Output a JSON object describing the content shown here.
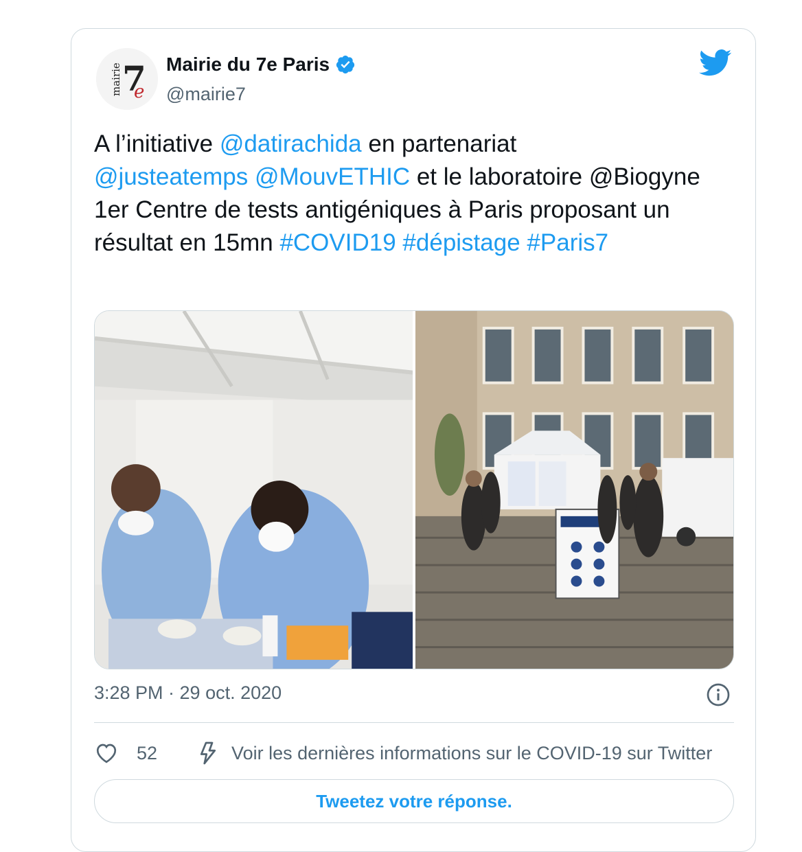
{
  "account": {
    "display_name": "Mairie du 7e Paris",
    "handle": "@mairie7",
    "avatar_text_small": "mairie",
    "avatar_text_big": "7",
    "avatar_text_e": "e"
  },
  "tweet": {
    "segments": [
      {
        "text": "A l’initiative ",
        "link": false
      },
      {
        "text": "@datirachida",
        "link": true
      },
      {
        "text": " en partenariat ",
        "link": false
      },
      {
        "text": "@justeatemps",
        "link": true
      },
      {
        "text": " ",
        "link": false
      },
      {
        "text": "@MouvETHIC",
        "link": true
      },
      {
        "text": " et le laboratoire @Biogyne 1er Centre de tests antigéniques à Paris proposant un résultat en 15mn ",
        "link": false
      },
      {
        "text": "#COVID19",
        "link": true
      },
      {
        "text": " ",
        "link": false
      },
      {
        "text": "#dépistage",
        "link": true
      },
      {
        "text": " ",
        "link": false
      },
      {
        "text": "#Paris7",
        "link": true
      }
    ],
    "timestamp": "3:28 PM · 29 oct. 2020"
  },
  "actions": {
    "like_count": "52",
    "covid_info": "Voir les dernières informations sur le COVID-19 sur Twitter"
  },
  "reply": {
    "label": "Tweetez votre réponse."
  },
  "colors": {
    "accent": "#1d9bf0",
    "text": "#0f1419",
    "muted": "#536471",
    "border": "#cfd9de"
  },
  "icons": {
    "verified": "verified-badge-icon",
    "brand": "twitter-bird-icon",
    "info": "info-icon",
    "like": "heart-icon",
    "bolt": "lightning-bolt-icon"
  }
}
